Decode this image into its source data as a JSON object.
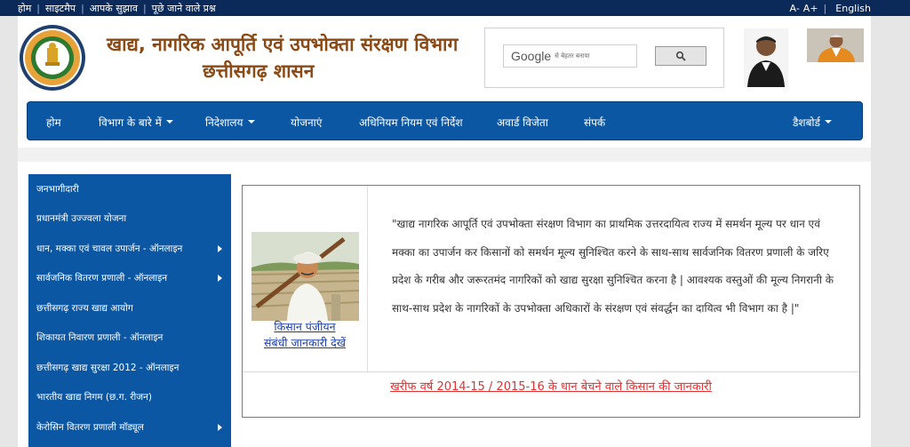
{
  "topbar": {
    "links": [
      "होम",
      "साइटमैप",
      "आपके सुझाव",
      "पूछे जाने वाले प्रश्न"
    ],
    "font_small": "A-",
    "font_large": "A+",
    "language": "English"
  },
  "header": {
    "title_line1": "खाद्य, नागरिक आपूर्ति एवं उपभोक्ता संरक्षण विभाग",
    "title_line2": "छत्तीसगढ़ शासन",
    "emblem_text": "छत्तीसगढ़ शासन",
    "search": {
      "logo_text": "Google",
      "placeholder_text": "से बेहतर बनाया",
      "button_icon": "search-icon"
    }
  },
  "nav": {
    "items": [
      {
        "label": "होम"
      },
      {
        "label": "विभाग के बारे में"
      },
      {
        "label": "निदेशालय"
      },
      {
        "label": "योजनाएं"
      },
      {
        "label": "अधिनियम नियम एवं निर्देश"
      },
      {
        "label": "अवार्ड विजेता"
      },
      {
        "label": "संपर्क"
      },
      {
        "label": "डैशबोर्ड"
      }
    ]
  },
  "sidebar": {
    "items": [
      {
        "label": "जनभागीदारी"
      },
      {
        "label": "प्रधानमंत्री उज्ज्वला योजना"
      },
      {
        "label": "धान, मक्का एवं चावल उपार्जन - ऑनलाइन"
      },
      {
        "label": "सार्वजनिक वितरण प्रणाली - ऑनलाइन"
      },
      {
        "label": "छत्तीसगढ़ राज्य खाद्य आयोग"
      },
      {
        "label": "शिकायत निवारण प्रणाली - ऑनलाइन"
      },
      {
        "label": "छत्तीसगढ़ खाद्य सुरक्षा 2012 - ऑनलाइन"
      },
      {
        "label": "भारतीय खाद्य निगम (छ.ग. रीजन)"
      },
      {
        "label": "केरोसिन वितरण प्रणाली मॉड्यूल"
      }
    ]
  },
  "content": {
    "kisan_link_line1": "किसान पंजीयन",
    "kisan_link_line2": "संबंधी जानकारी देखें",
    "quote": "\"खाद्य नागरिक आपूर्ति एवं उपभोक्ता संरक्षण विभाग का प्राथमिक उत्तरदायित्व राज्य में समर्थन मूल्य पर धान एवं मक्का का उपार्जन कर किसानों को समर्थन मूल्य सुनिश्चित करने के साथ-साथ सार्वजनिक वितरण प्रणाली के जरिए प्रदेश के गरीब और जरूरतमंद नागरिकों को खाद्य सुरक्षा सुनिश्चित करना है | आवश्यक वस्तुओं की मूल्य निगरानी के साथ-साथ प्रदेश के नागरिकों के उपभोक्ता अधिकारों के संरक्षण एवं संवर्द्धन का दायित्व भी विभाग का है |\"",
    "kharif_link": "खरीफ वर्ष 2014-15 / 2015-16 के धान बेचने वाले किसान की जानकारी"
  },
  "colors": {
    "topbar": "#0b2a59",
    "nav": "#0b57a4",
    "sidebar": "#0b57a4",
    "title": "#8b4a14",
    "link": "#1a3ea8",
    "alert_link": "#e53030"
  }
}
